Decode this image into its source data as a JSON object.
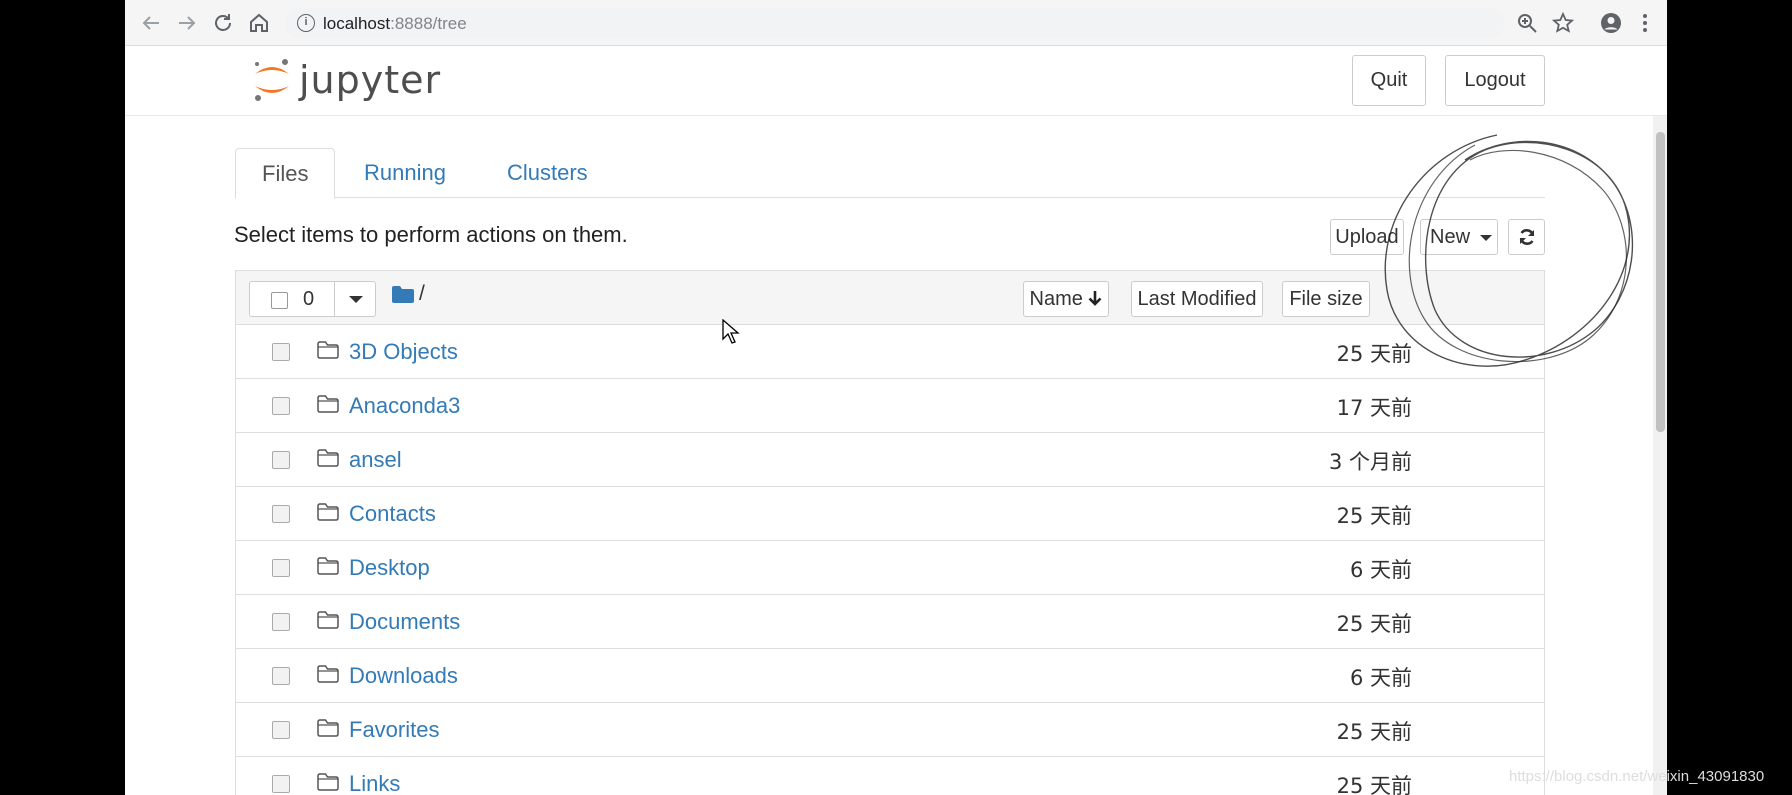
{
  "browser": {
    "url_host": "localhost",
    "url_rest": ":8888/tree",
    "back_icon": "arrow-left-icon",
    "forward_icon": "arrow-right-icon",
    "reload_icon": "reload-icon",
    "home_icon": "home-icon"
  },
  "header": {
    "logo_text": "jupyter",
    "quit_label": "Quit",
    "logout_label": "Logout"
  },
  "tabs": [
    {
      "label": "Files",
      "active": true
    },
    {
      "label": "Running",
      "active": false
    },
    {
      "label": "Clusters",
      "active": false
    }
  ],
  "toolbar": {
    "hint": "Select items to perform actions on them.",
    "upload_label": "Upload",
    "new_label": "New"
  },
  "list_header": {
    "selected_count": "0",
    "breadcrumb": "/",
    "sort_name_label": "Name",
    "sort_modified_label": "Last Modified",
    "sort_size_label": "File size"
  },
  "files": [
    {
      "name": "3D Objects",
      "modified": "25 天前"
    },
    {
      "name": "Anaconda3",
      "modified": "17 天前"
    },
    {
      "name": "ansel",
      "modified": "3 个月前"
    },
    {
      "name": "Contacts",
      "modified": "25 天前"
    },
    {
      "name": "Desktop",
      "modified": "6 天前"
    },
    {
      "name": "Documents",
      "modified": "25 天前"
    },
    {
      "name": "Downloads",
      "modified": "6 天前"
    },
    {
      "name": "Favorites",
      "modified": "25 天前"
    },
    {
      "name": "Links",
      "modified": "25 天前"
    }
  ],
  "watermark": "https://blog.csdn.net/weixin_43091830",
  "colors": {
    "link": "#337ab7",
    "logo_orange": "#f37726",
    "folder_blue": "#337ab7"
  }
}
